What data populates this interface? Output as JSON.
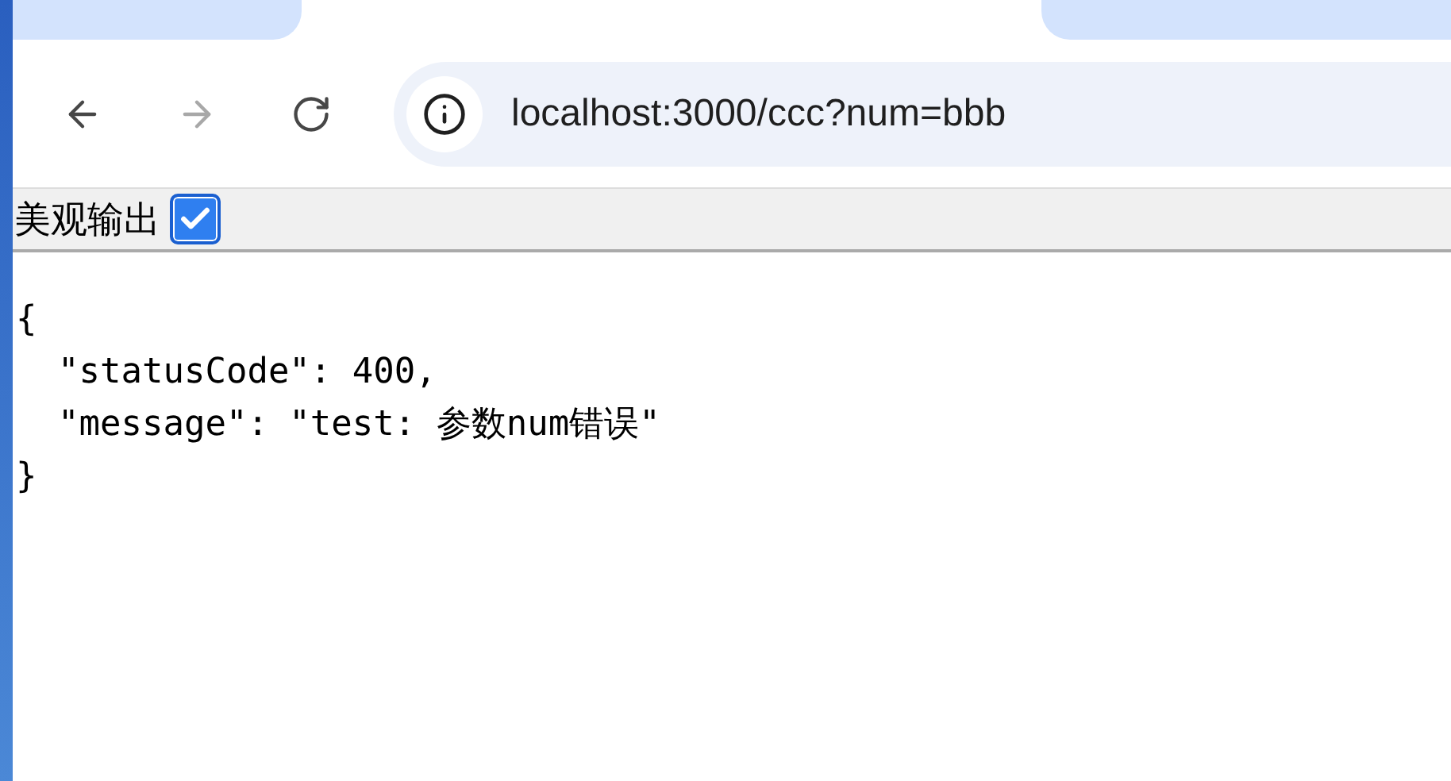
{
  "toolbar": {
    "buttons": [
      {
        "kind": "back",
        "disabled": false
      },
      {
        "kind": "forward",
        "disabled": true
      },
      {
        "kind": "reload",
        "disabled": false
      }
    ],
    "address_bar": {
      "url": "localhost:3000/ccc?num=bbb"
    }
  },
  "page": {
    "pretty_option": {
      "label": "美观输出",
      "checked": true
    },
    "output_lines": [
      "{",
      "  \"statusCode\": 400,",
      "  \"message\": \"test: 参数num错误\"",
      "}"
    ]
  }
}
